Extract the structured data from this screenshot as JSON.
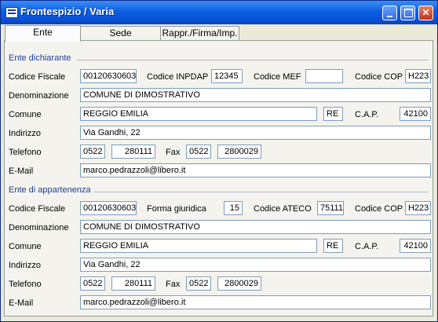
{
  "window": {
    "title": "Frontespizio / Varia"
  },
  "tabs": [
    {
      "label": "Ente",
      "active": true
    },
    {
      "label": "Sede",
      "active": false
    },
    {
      "label": "Rappr./Firma/Imp.",
      "active": false
    }
  ],
  "dichiarante": {
    "section_title": "Ente dichiarante",
    "labels": {
      "codice_fiscale": "Codice Fiscale",
      "codice_inpdap": "Codice INPDAP",
      "codice_mef": "Codice MEF",
      "codice_cop": "Codice COP",
      "denominazione": "Denominazione",
      "comune": "Comune",
      "cap": "C.A.P.",
      "indirizzo": "Indirizzo",
      "telefono": "Telefono",
      "fax": "Fax",
      "email": "E-Mail"
    },
    "values": {
      "codice_fiscale": "00120630603",
      "codice_inpdap": "12345",
      "codice_mef": "",
      "codice_cop": "H223",
      "denominazione": "COMUNE DI DIMOSTRATIVO",
      "comune": "REGGIO EMILIA",
      "provincia": "RE",
      "cap": "42100",
      "indirizzo": "Via Gandhi, 22",
      "tel_prefisso": "0522",
      "tel_numero": "280111",
      "fax_prefisso": "0522",
      "fax_numero": "2800029",
      "email": "marco.pedrazzoli@libero.it"
    }
  },
  "appartenenza": {
    "section_title": "Ente di appartenenza",
    "labels": {
      "codice_fiscale": "Codice Fiscale",
      "forma_giuridica": "Forma giuridica",
      "codice_ateco": "Codice ATECO",
      "codice_cop": "Codice COP",
      "denominazione": "Denominazione",
      "comune": "Comune",
      "cap": "C.A.P.",
      "indirizzo": "Indirizzo",
      "telefono": "Telefono",
      "fax": "Fax",
      "email": "E-Mail"
    },
    "values": {
      "codice_fiscale": "00120630603",
      "forma_giuridica": "15",
      "codice_ateco": "75111",
      "codice_cop": "H223",
      "denominazione": "COMUNE DI DIMOSTRATIVO",
      "comune": "REGGIO EMILIA",
      "provincia": "RE",
      "cap": "42100",
      "indirizzo": "Via Gandhi, 22",
      "tel_prefisso": "0522",
      "tel_numero": "280111",
      "fax_prefisso": "0522",
      "fax_numero": "2800029",
      "email": "marco.pedrazzoli@libero.it"
    }
  }
}
